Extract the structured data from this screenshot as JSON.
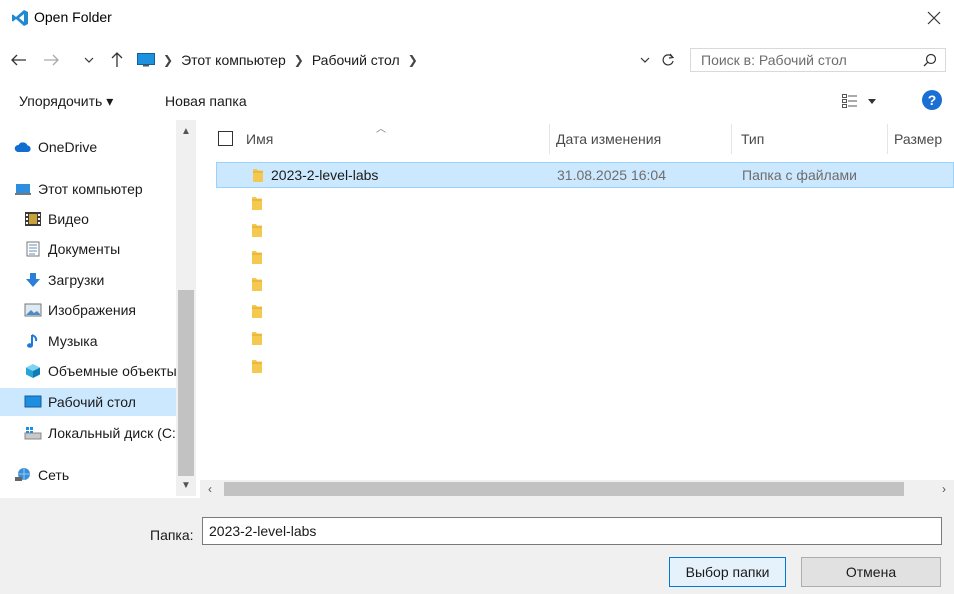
{
  "window": {
    "title": "Open Folder",
    "app_icon": "vscode-icon",
    "close_icon": "close-icon"
  },
  "nav": {
    "back_icon": "arrow-left-icon",
    "forward_icon": "arrow-right-icon",
    "recent_icon": "chevron-down-icon",
    "up_icon": "arrow-up-icon",
    "breadcrumbs": [
      "Этот компьютер",
      "Рабочий стол"
    ],
    "search_placeholder": "Поиск в: Рабочий стол"
  },
  "toolbar": {
    "organize_label": "Упорядочить ▾",
    "new_folder_label": "Новая папка",
    "help_label": "?"
  },
  "sidebar": {
    "items": [
      {
        "label": "OneDrive",
        "icon": "cloud-icon"
      },
      {
        "label": "Этот компьютер",
        "icon": "computer-icon"
      },
      {
        "label": "Видео",
        "icon": "video-icon"
      },
      {
        "label": "Документы",
        "icon": "document-icon"
      },
      {
        "label": "Загрузки",
        "icon": "download-icon"
      },
      {
        "label": "Изображения",
        "icon": "image-icon"
      },
      {
        "label": "Музыка",
        "icon": "music-icon"
      },
      {
        "label": "Объемные объекты",
        "icon": "cube-icon"
      },
      {
        "label": "Рабочий стол",
        "icon": "desktop-icon",
        "selected": true
      },
      {
        "label": "Локальный диск (C:)",
        "icon": "drive-icon"
      },
      {
        "label": "Сеть",
        "icon": "network-icon"
      }
    ]
  },
  "filelist": {
    "columns": {
      "name": "Имя",
      "date": "Дата изменения",
      "type": "Тип",
      "size": "Размер"
    },
    "rows": [
      {
        "name": "2023-2-level-labs",
        "date": "31.08.2025 16:04",
        "type": "Папка с файлами",
        "selected": true
      },
      {
        "name": "",
        "date": "",
        "type": ""
      },
      {
        "name": "",
        "date": "",
        "type": ""
      },
      {
        "name": "",
        "date": "",
        "type": ""
      },
      {
        "name": "",
        "date": "",
        "type": ""
      },
      {
        "name": "",
        "date": "",
        "type": ""
      },
      {
        "name": "",
        "date": "",
        "type": ""
      },
      {
        "name": "",
        "date": "",
        "type": ""
      }
    ]
  },
  "bottom": {
    "folder_label": "Папка:",
    "folder_value": "2023-2-level-labs",
    "select_button": "Выбор папки",
    "cancel_button": "Отмена"
  },
  "colors": {
    "accent": "#0078d7",
    "selection": "#cce8ff",
    "folder": "#f4c94f",
    "help_blue": "#1a6fd4"
  }
}
